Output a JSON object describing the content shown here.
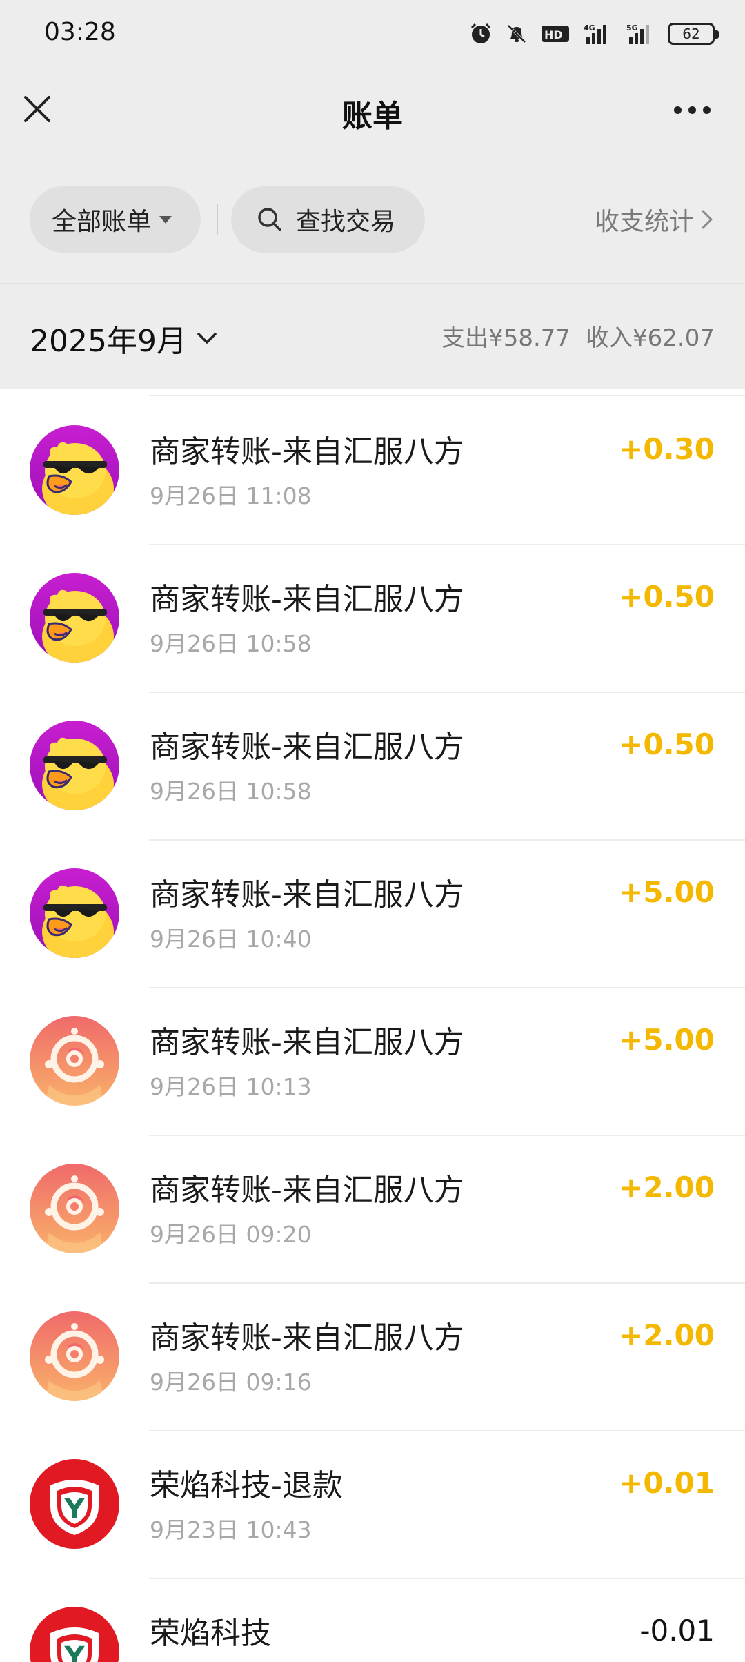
{
  "status_bar": {
    "time": "03:28",
    "battery": "62"
  },
  "nav": {
    "title": "账单"
  },
  "filter": {
    "all_label": "全部账单",
    "search_label": "查找交易",
    "stats_label": "收支统计"
  },
  "month": {
    "label": "2025年9月",
    "expense": "支出¥58.77",
    "income": "收入¥62.07"
  },
  "transactions": [
    {
      "title": "商家转账-来自汇服八方",
      "time": "9月26日 11:08",
      "amount": "+0.30",
      "avatar": "duck-avatar"
    },
    {
      "title": "商家转账-来自汇服八方",
      "time": "9月26日 10:58",
      "amount": "+0.50",
      "avatar": "duck-avatar"
    },
    {
      "title": "商家转账-来自汇服八方",
      "time": "9月26日 10:58",
      "amount": "+0.50",
      "avatar": "duck-avatar"
    },
    {
      "title": "商家转账-来自汇服八方",
      "time": "9月26日 10:40",
      "amount": "+5.00",
      "avatar": "duck-avatar"
    },
    {
      "title": "商家转账-来自汇服八方",
      "time": "9月26日 10:13",
      "amount": "+5.00",
      "avatar": "sun-logo-avatar"
    },
    {
      "title": "商家转账-来自汇服八方",
      "time": "9月26日 09:20",
      "amount": "+2.00",
      "avatar": "sun-logo-avatar"
    },
    {
      "title": "商家转账-来自汇服八方",
      "time": "9月26日 09:16",
      "amount": "+2.00",
      "avatar": "sun-logo-avatar"
    },
    {
      "title": "荣焰科技-退款",
      "time": "9月23日 10:43",
      "amount": "+0.01",
      "avatar": "y-shield-avatar"
    },
    {
      "title": "荣焰科技",
      "time": "",
      "amount": "-0.01",
      "avatar": "y-shield-avatar"
    }
  ]
}
